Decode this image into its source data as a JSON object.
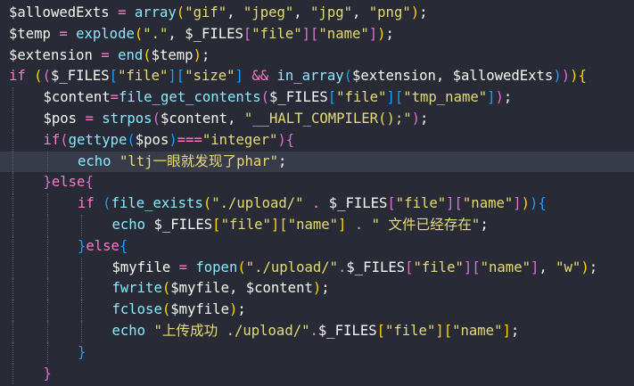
{
  "editor": {
    "language": "php",
    "theme_colors": {
      "background": "#282a36",
      "current_line": "#383b4a",
      "default_text": "#f8f8f2",
      "keyword_operator": "#ff79c6",
      "function": "#8be9fd",
      "string": "#e6db74",
      "bracket_level_1": "#ffd700",
      "bracket_level_2": "#da70d6",
      "bracket_level_3": "#179fff"
    },
    "current_line_index": 7,
    "lines": [
      {
        "indent": 0,
        "tokens": [
          {
            "t": "$allowedExts",
            "c": "var"
          },
          {
            "t": " ",
            "c": "pn"
          },
          {
            "t": "=",
            "c": "op"
          },
          {
            "t": " ",
            "c": "pn"
          },
          {
            "t": "array",
            "c": "fn"
          },
          {
            "t": "(",
            "c": "br1"
          },
          {
            "t": "\"gif\"",
            "c": "str"
          },
          {
            "t": ", ",
            "c": "pn"
          },
          {
            "t": "\"jpeg\"",
            "c": "str"
          },
          {
            "t": ", ",
            "c": "pn"
          },
          {
            "t": "\"jpg\"",
            "c": "str"
          },
          {
            "t": ", ",
            "c": "pn"
          },
          {
            "t": "\"png\"",
            "c": "str"
          },
          {
            "t": ")",
            "c": "br1"
          },
          {
            "t": ";",
            "c": "pn"
          }
        ]
      },
      {
        "indent": 0,
        "tokens": [
          {
            "t": "$temp",
            "c": "var"
          },
          {
            "t": " ",
            "c": "pn"
          },
          {
            "t": "=",
            "c": "op"
          },
          {
            "t": " ",
            "c": "pn"
          },
          {
            "t": "explode",
            "c": "fn"
          },
          {
            "t": "(",
            "c": "br1"
          },
          {
            "t": "\".\"",
            "c": "str"
          },
          {
            "t": ", ",
            "c": "pn"
          },
          {
            "t": "$_FILES",
            "c": "var"
          },
          {
            "t": "[",
            "c": "br2"
          },
          {
            "t": "\"file\"",
            "c": "str"
          },
          {
            "t": "]",
            "c": "br2"
          },
          {
            "t": "[",
            "c": "br2"
          },
          {
            "t": "\"name\"",
            "c": "str"
          },
          {
            "t": "]",
            "c": "br2"
          },
          {
            "t": ")",
            "c": "br1"
          },
          {
            "t": ";",
            "c": "pn"
          }
        ]
      },
      {
        "indent": 0,
        "tokens": [
          {
            "t": "$extension",
            "c": "var"
          },
          {
            "t": " ",
            "c": "pn"
          },
          {
            "t": "=",
            "c": "op"
          },
          {
            "t": " ",
            "c": "pn"
          },
          {
            "t": "end",
            "c": "fn"
          },
          {
            "t": "(",
            "c": "br1"
          },
          {
            "t": "$temp",
            "c": "var"
          },
          {
            "t": ")",
            "c": "br1"
          },
          {
            "t": ";",
            "c": "pn"
          }
        ]
      },
      {
        "indent": 0,
        "tokens": [
          {
            "t": "if",
            "c": "kw"
          },
          {
            "t": " ",
            "c": "pn"
          },
          {
            "t": "(",
            "c": "br1"
          },
          {
            "t": "(",
            "c": "br2"
          },
          {
            "t": "$_FILES",
            "c": "var"
          },
          {
            "t": "[",
            "c": "br3"
          },
          {
            "t": "\"file\"",
            "c": "str"
          },
          {
            "t": "]",
            "c": "br3"
          },
          {
            "t": "[",
            "c": "br3"
          },
          {
            "t": "\"size\"",
            "c": "str"
          },
          {
            "t": "]",
            "c": "br3"
          },
          {
            "t": " ",
            "c": "pn"
          },
          {
            "t": "&&",
            "c": "op"
          },
          {
            "t": " ",
            "c": "pn"
          },
          {
            "t": "in_array",
            "c": "fn"
          },
          {
            "t": "(",
            "c": "br3"
          },
          {
            "t": "$extension",
            "c": "var"
          },
          {
            "t": ", ",
            "c": "pn"
          },
          {
            "t": "$allowedExts",
            "c": "var"
          },
          {
            "t": ")",
            "c": "br3"
          },
          {
            "t": ")",
            "c": "br2"
          },
          {
            "t": ")",
            "c": "br1"
          },
          {
            "t": "{",
            "c": "br1"
          }
        ]
      },
      {
        "indent": 1,
        "tokens": [
          {
            "t": "$content",
            "c": "var"
          },
          {
            "t": "=",
            "c": "op"
          },
          {
            "t": "file_get_contents",
            "c": "fn"
          },
          {
            "t": "(",
            "c": "br2"
          },
          {
            "t": "$_FILES",
            "c": "var"
          },
          {
            "t": "[",
            "c": "br3"
          },
          {
            "t": "\"file\"",
            "c": "str"
          },
          {
            "t": "]",
            "c": "br3"
          },
          {
            "t": "[",
            "c": "br3"
          },
          {
            "t": "\"tmp_name\"",
            "c": "str"
          },
          {
            "t": "]",
            "c": "br3"
          },
          {
            "t": ")",
            "c": "br2"
          },
          {
            "t": ";",
            "c": "pn"
          }
        ]
      },
      {
        "indent": 1,
        "tokens": [
          {
            "t": "$pos",
            "c": "var"
          },
          {
            "t": " ",
            "c": "pn"
          },
          {
            "t": "=",
            "c": "op"
          },
          {
            "t": " ",
            "c": "pn"
          },
          {
            "t": "strpos",
            "c": "fn"
          },
          {
            "t": "(",
            "c": "br2"
          },
          {
            "t": "$content",
            "c": "var"
          },
          {
            "t": ", ",
            "c": "pn"
          },
          {
            "t": "\"__HALT_COMPILER();\"",
            "c": "str"
          },
          {
            "t": ")",
            "c": "br2"
          },
          {
            "t": ";",
            "c": "pn"
          }
        ]
      },
      {
        "indent": 1,
        "tokens": [
          {
            "t": "if",
            "c": "kw"
          },
          {
            "t": "(",
            "c": "br2"
          },
          {
            "t": "gettype",
            "c": "fn"
          },
          {
            "t": "(",
            "c": "br3"
          },
          {
            "t": "$pos",
            "c": "var"
          },
          {
            "t": ")",
            "c": "br3"
          },
          {
            "t": "===",
            "c": "op"
          },
          {
            "t": "\"integer\"",
            "c": "str"
          },
          {
            "t": ")",
            "c": "br2"
          },
          {
            "t": "{",
            "c": "br2"
          }
        ]
      },
      {
        "indent": 2,
        "tokens": [
          {
            "t": "echo",
            "c": "fn"
          },
          {
            "t": " ",
            "c": "pn"
          },
          {
            "t": "\"ltj一眼就发现了phar\"",
            "c": "str"
          },
          {
            "t": ";",
            "c": "pn"
          }
        ]
      },
      {
        "indent": 1,
        "tokens": [
          {
            "t": "}",
            "c": "br2"
          },
          {
            "t": "else",
            "c": "kw"
          },
          {
            "t": "{",
            "c": "br2"
          }
        ]
      },
      {
        "indent": 2,
        "tokens": [
          {
            "t": "if",
            "c": "kw"
          },
          {
            "t": " ",
            "c": "pn"
          },
          {
            "t": "(",
            "c": "br3"
          },
          {
            "t": "file_exists",
            "c": "fn"
          },
          {
            "t": "(",
            "c": "br1"
          },
          {
            "t": "\"./upload/\"",
            "c": "str"
          },
          {
            "t": " ",
            "c": "pn"
          },
          {
            "t": ".",
            "c": "op"
          },
          {
            "t": " ",
            "c": "pn"
          },
          {
            "t": "$_FILES",
            "c": "var"
          },
          {
            "t": "[",
            "c": "br2"
          },
          {
            "t": "\"file\"",
            "c": "str"
          },
          {
            "t": "]",
            "c": "br2"
          },
          {
            "t": "[",
            "c": "br2"
          },
          {
            "t": "\"name\"",
            "c": "str"
          },
          {
            "t": "]",
            "c": "br2"
          },
          {
            "t": ")",
            "c": "br1"
          },
          {
            "t": ")",
            "c": "br3"
          },
          {
            "t": "{",
            "c": "br3"
          }
        ]
      },
      {
        "indent": 3,
        "tokens": [
          {
            "t": "echo",
            "c": "fn"
          },
          {
            "t": " ",
            "c": "pn"
          },
          {
            "t": "$_FILES",
            "c": "var"
          },
          {
            "t": "[",
            "c": "br1"
          },
          {
            "t": "\"file\"",
            "c": "str"
          },
          {
            "t": "]",
            "c": "br1"
          },
          {
            "t": "[",
            "c": "br1"
          },
          {
            "t": "\"name\"",
            "c": "str"
          },
          {
            "t": "]",
            "c": "br1"
          },
          {
            "t": " ",
            "c": "pn"
          },
          {
            "t": ".",
            "c": "op"
          },
          {
            "t": " ",
            "c": "pn"
          },
          {
            "t": "\" 文件已经存在\"",
            "c": "str"
          },
          {
            "t": ";",
            "c": "pn"
          }
        ]
      },
      {
        "indent": 2,
        "tokens": [
          {
            "t": "}",
            "c": "br3"
          },
          {
            "t": "else",
            "c": "kw"
          },
          {
            "t": "{",
            "c": "br3"
          }
        ]
      },
      {
        "indent": 3,
        "tokens": [
          {
            "t": "$myfile",
            "c": "var"
          },
          {
            "t": " ",
            "c": "pn"
          },
          {
            "t": "=",
            "c": "op"
          },
          {
            "t": " ",
            "c": "pn"
          },
          {
            "t": "fopen",
            "c": "fn"
          },
          {
            "t": "(",
            "c": "br1"
          },
          {
            "t": "\"./upload/\"",
            "c": "str"
          },
          {
            "t": ".",
            "c": "op"
          },
          {
            "t": "$_FILES",
            "c": "var"
          },
          {
            "t": "[",
            "c": "br2"
          },
          {
            "t": "\"file\"",
            "c": "str"
          },
          {
            "t": "]",
            "c": "br2"
          },
          {
            "t": "[",
            "c": "br2"
          },
          {
            "t": "\"name\"",
            "c": "str"
          },
          {
            "t": "]",
            "c": "br2"
          },
          {
            "t": ", ",
            "c": "pn"
          },
          {
            "t": "\"w\"",
            "c": "str"
          },
          {
            "t": ")",
            "c": "br1"
          },
          {
            "t": ";",
            "c": "pn"
          }
        ]
      },
      {
        "indent": 3,
        "tokens": [
          {
            "t": "fwrite",
            "c": "fn"
          },
          {
            "t": "(",
            "c": "br1"
          },
          {
            "t": "$myfile",
            "c": "var"
          },
          {
            "t": ", ",
            "c": "pn"
          },
          {
            "t": "$content",
            "c": "var"
          },
          {
            "t": ")",
            "c": "br1"
          },
          {
            "t": ";",
            "c": "pn"
          }
        ]
      },
      {
        "indent": 3,
        "tokens": [
          {
            "t": "fclose",
            "c": "fn"
          },
          {
            "t": "(",
            "c": "br1"
          },
          {
            "t": "$myfile",
            "c": "var"
          },
          {
            "t": ")",
            "c": "br1"
          },
          {
            "t": ";",
            "c": "pn"
          }
        ]
      },
      {
        "indent": 3,
        "tokens": [
          {
            "t": "echo",
            "c": "fn"
          },
          {
            "t": " ",
            "c": "pn"
          },
          {
            "t": "\"上传成功 ./upload/\"",
            "c": "str"
          },
          {
            "t": ".",
            "c": "op"
          },
          {
            "t": "$_FILES",
            "c": "var"
          },
          {
            "t": "[",
            "c": "br1"
          },
          {
            "t": "\"file\"",
            "c": "str"
          },
          {
            "t": "]",
            "c": "br1"
          },
          {
            "t": "[",
            "c": "br1"
          },
          {
            "t": "\"name\"",
            "c": "str"
          },
          {
            "t": "]",
            "c": "br1"
          },
          {
            "t": ";",
            "c": "pn"
          }
        ]
      },
      {
        "indent": 2,
        "tokens": [
          {
            "t": "}",
            "c": "br3"
          }
        ]
      },
      {
        "indent": 1,
        "tokens": [
          {
            "t": "}",
            "c": "br2"
          }
        ]
      }
    ]
  }
}
